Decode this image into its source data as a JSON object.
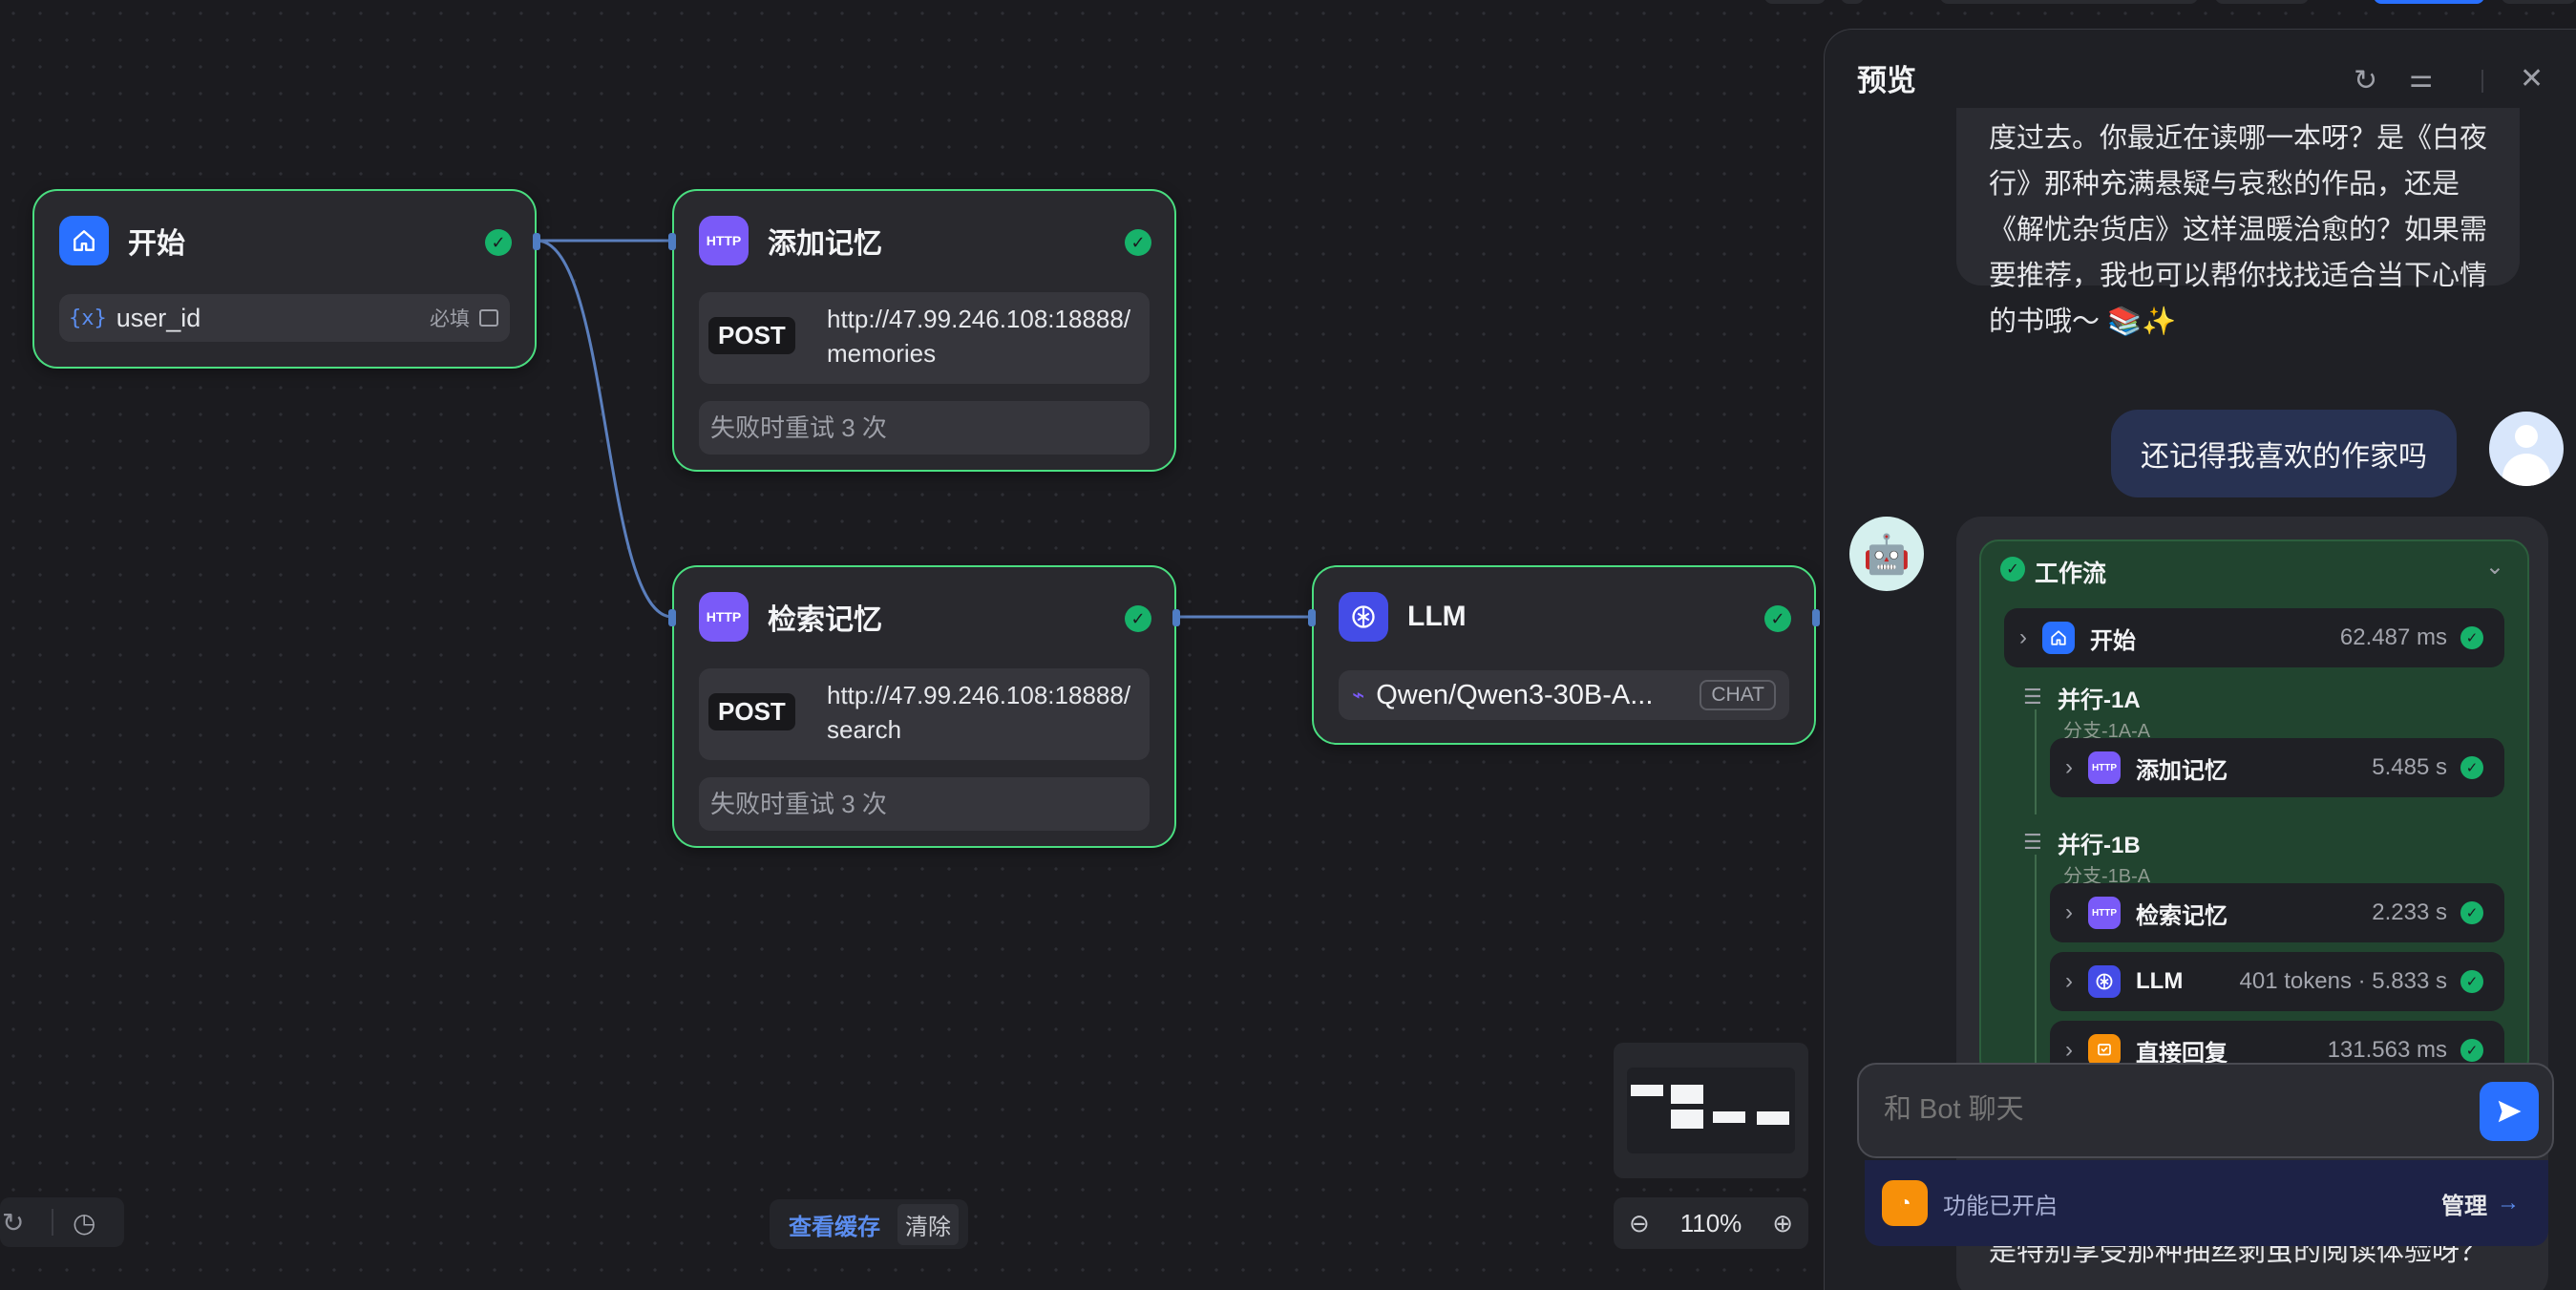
{
  "nodes": {
    "start": {
      "title": "开始",
      "var_name": "user_id",
      "required_label": "必填"
    },
    "add_memory": {
      "title": "添加记忆",
      "method": "POST",
      "url": "http://47.99.246.108:18888/memories",
      "retry": "失败时重试 3 次",
      "icon_text": "HTTP"
    },
    "search_memory": {
      "title": "检索记忆",
      "method": "POST",
      "url": "http://47.99.246.108:18888/search",
      "retry": "失败时重试 3 次",
      "icon_text": "HTTP"
    },
    "llm": {
      "title": "LLM",
      "model": "Qwen/Qwen3-30B-A...",
      "mode": "CHAT"
    }
  },
  "canvas_controls": {
    "view_cache": "查看缓存",
    "clear": "清除",
    "zoom": "110%"
  },
  "preview": {
    "title": "预览",
    "bot_message_lines": [
      "度过去。你最近在读哪一本呀？是《白夜",
      "行》那种充满悬疑与哀愁的作品，还是",
      "《解忧杂货店》这样温暖治愈的？如果需",
      "要推荐，我也可以帮你找找适合当下心情",
      "的书哦～ 📚✨"
    ],
    "user_message": "还记得我喜欢的作家吗",
    "workflow": {
      "title": "工作流",
      "start": {
        "name": "开始",
        "time": "62.487 ms"
      },
      "group_a": {
        "title": "并行-1A",
        "branch": "分支-1A-A",
        "items": [
          {
            "name": "添加记忆",
            "time": "5.485 s",
            "icon_text": "HTTP"
          }
        ]
      },
      "group_b": {
        "title": "并行-1B",
        "branch": "分支-1B-A",
        "items": [
          {
            "name": "检索记忆",
            "time": "2.233 s",
            "icon_text": "HTTP"
          },
          {
            "name": "LLM",
            "time": "401 tokens · 5.833 s"
          },
          {
            "name": "直接回复",
            "time": "131.563 ms"
          }
        ]
      }
    },
    "input_placeholder": "和 Bot 聊天",
    "feature_status": "功能已开启",
    "manage_label": "管理",
    "bottom_text": "是特别享受那种抽丝剥茧的阅读体验呀？"
  },
  "colors": {
    "success": "#17b26a",
    "accent": "#2970ff",
    "node_border": "#4ade80"
  }
}
